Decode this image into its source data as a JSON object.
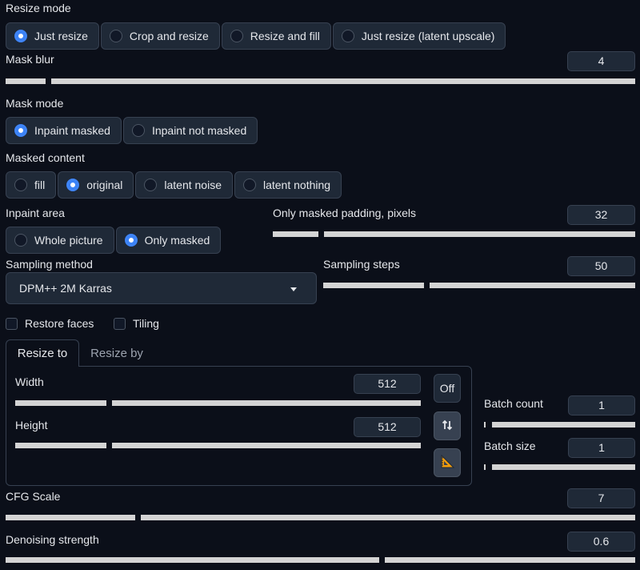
{
  "resize_mode": {
    "label": "Resize mode",
    "options": [
      "Just resize",
      "Crop and resize",
      "Resize and fill",
      "Just resize (latent upscale)"
    ],
    "selected": "Just resize"
  },
  "mask_blur": {
    "label": "Mask blur",
    "value": "4",
    "fraction": 0.07
  },
  "mask_mode": {
    "label": "Mask mode",
    "options": [
      "Inpaint masked",
      "Inpaint not masked"
    ],
    "selected": "Inpaint masked"
  },
  "masked_content": {
    "label": "Masked content",
    "options": [
      "fill",
      "original",
      "latent noise",
      "latent nothing"
    ],
    "selected": "original"
  },
  "inpaint_area": {
    "label": "Inpaint area",
    "options": [
      "Whole picture",
      "Only masked"
    ],
    "selected": "Only masked"
  },
  "only_masked_padding": {
    "label": "Only masked padding, pixels",
    "value": "32",
    "fraction": 0.13
  },
  "sampling_method": {
    "label": "Sampling method",
    "value": "DPM++ 2M Karras"
  },
  "sampling_steps": {
    "label": "Sampling steps",
    "value": "50",
    "fraction": 0.33
  },
  "checkboxes": {
    "restore_faces": "Restore faces",
    "tiling": "Tiling"
  },
  "tabs": {
    "resize_to": "Resize to",
    "resize_by": "Resize by",
    "active": "Resize to"
  },
  "width": {
    "label": "Width",
    "value": "512",
    "fraction": 0.23
  },
  "height": {
    "label": "Height",
    "value": "512",
    "fraction": 0.23
  },
  "tools": {
    "off_label": "Off",
    "swap_icon": "swap-vertical-icon",
    "ratio_icon": "triangle-ruler-icon"
  },
  "batch_count": {
    "label": "Batch count",
    "value": "1",
    "fraction": 0.0
  },
  "batch_size": {
    "label": "Batch size",
    "value": "1",
    "fraction": 0.0
  },
  "cfg_scale": {
    "label": "CFG Scale",
    "value": "7",
    "fraction": 0.21
  },
  "denoising_strength": {
    "label": "Denoising strength",
    "value": "0.6",
    "fraction": 0.6
  },
  "colors": {
    "accent": "#3b82f6",
    "background": "#0b0f19",
    "panel": "#1f2937",
    "track": "#d4d4d4"
  }
}
